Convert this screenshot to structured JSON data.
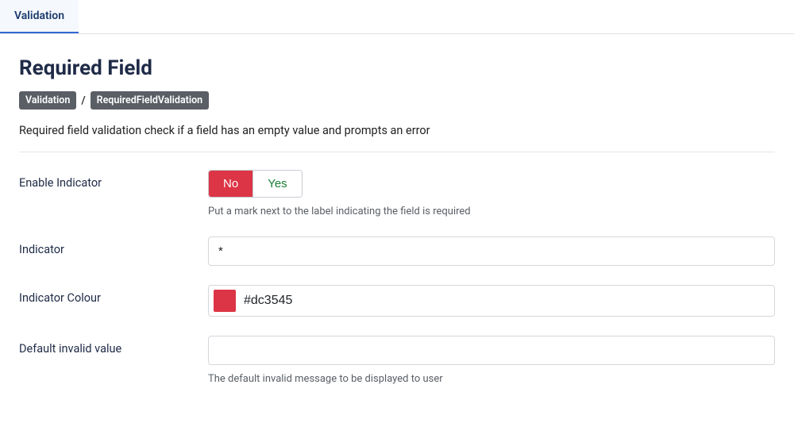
{
  "tab": {
    "label": "Validation"
  },
  "page": {
    "title": "Required Field",
    "breadcrumb": {
      "item1": "Validation",
      "sep": "/",
      "item2": "RequiredFieldValidation"
    },
    "description": "Required field validation check if a field has an empty value and prompts an error"
  },
  "fields": {
    "enableIndicator": {
      "label": "Enable Indicator",
      "noLabel": "No",
      "yesLabel": "Yes",
      "help": "Put a mark next to the label indicating the field is required"
    },
    "indicator": {
      "label": "Indicator",
      "value": "*"
    },
    "indicatorColour": {
      "label": "Indicator Colour",
      "value": "#dc3545",
      "swatchColor": "#dc3545"
    },
    "defaultInvalid": {
      "label": "Default invalid value",
      "value": "",
      "help": "The default invalid message to be displayed to user"
    }
  }
}
